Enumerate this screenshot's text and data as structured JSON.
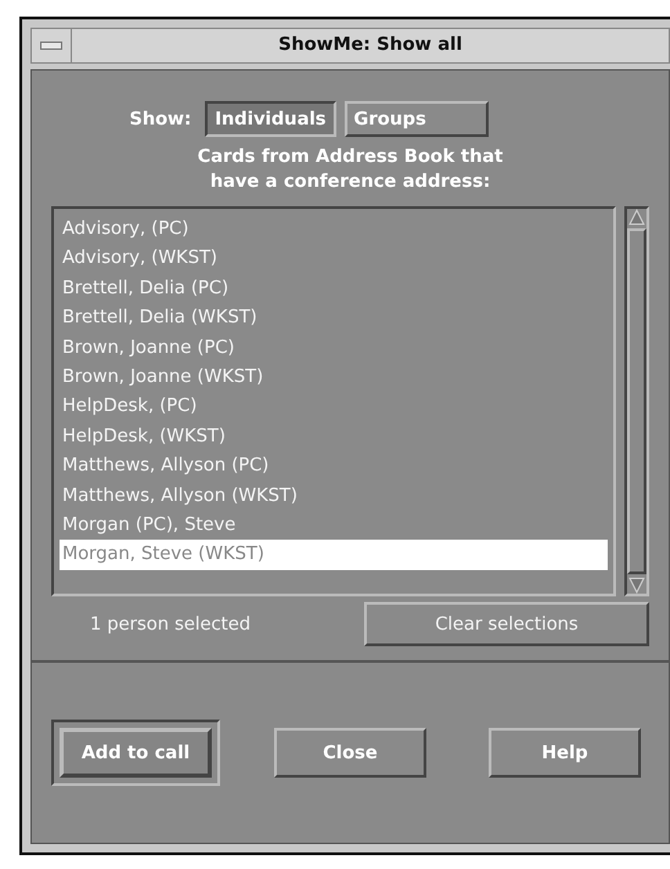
{
  "window": {
    "title": "ShowMe: Show all"
  },
  "show": {
    "label": "Show:",
    "tabs": [
      {
        "label": "Individuals",
        "selected": true
      },
      {
        "label": "Groups",
        "selected": false
      }
    ]
  },
  "description": "Cards from Address Book that have a conference address:",
  "list": [
    {
      "label": "Advisory, (PC)",
      "selected": false
    },
    {
      "label": "Advisory, (WKST)",
      "selected": false
    },
    {
      "label": "Brettell, Delia (PC)",
      "selected": false
    },
    {
      "label": "Brettell, Delia (WKST)",
      "selected": false
    },
    {
      "label": "Brown, Joanne (PC)",
      "selected": false
    },
    {
      "label": "Brown, Joanne (WKST)",
      "selected": false
    },
    {
      "label": "HelpDesk, (PC)",
      "selected": false
    },
    {
      "label": "HelpDesk, (WKST)",
      "selected": false
    },
    {
      "label": "Matthews, Allyson (PC)",
      "selected": false
    },
    {
      "label": "Matthews, Allyson (WKST)",
      "selected": false
    },
    {
      "label": "Morgan (PC), Steve",
      "selected": false
    },
    {
      "label": "Morgan, Steve (WKST)",
      "selected": true
    }
  ],
  "status": "1 person selected",
  "clear_button": "Clear selections",
  "buttons": [
    {
      "label": "Add to call",
      "default": true
    },
    {
      "label": "Close",
      "default": false
    },
    {
      "label": "Help",
      "default": false
    }
  ]
}
